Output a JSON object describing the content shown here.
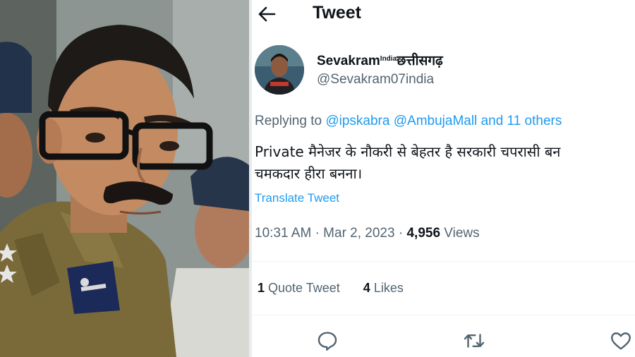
{
  "header": {
    "title": "Tweet"
  },
  "tweet": {
    "display_name": "Sevakram",
    "name_superscript": "India",
    "name_suffix": "छत्तीसगढ़",
    "handle": "@Sevakram07india",
    "replying_prefix": "Replying to",
    "replying_users": [
      "@ipskabra",
      "@AmbujaMall"
    ],
    "replying_others": "and 11 others",
    "text_line1": "Private मैनेजर के नौकरी से बेहतर है सरकारी चपरासी बन",
    "text_line2": "चमकदार हीरा बनना।",
    "translate_label": "Translate Tweet",
    "time": "10:31 AM",
    "date": "Mar 2, 2023",
    "views_count": "4,956",
    "views_label": "Views",
    "quote_count": "1",
    "quote_label": "Quote Tweet",
    "likes_count": "4",
    "likes_label": "Likes"
  },
  "icons": {
    "back": "arrow-left-icon",
    "reply": "reply-icon",
    "retweet": "retweet-icon",
    "like": "heart-icon"
  },
  "colors": {
    "accent": "#1d9bf0",
    "text_primary": "#0f1419",
    "text_secondary": "#536471"
  }
}
